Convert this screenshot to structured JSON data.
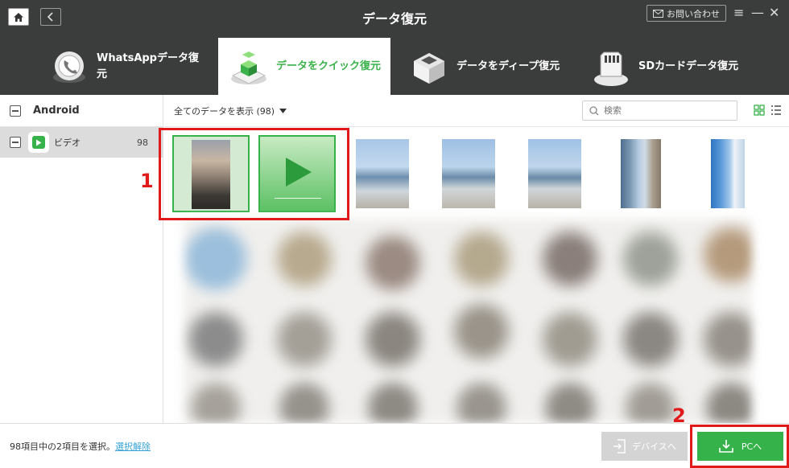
{
  "header": {
    "title": "データ復元",
    "contact_label": "お問い合わせ",
    "tabs": [
      {
        "label": "WhatsAppデータ復元",
        "line1": "WhatsAppデータ復",
        "line2": "元",
        "icon": "whatsapp-phone-icon",
        "active": false
      },
      {
        "label": "データをクイック復元",
        "icon": "quick-restore-cube-icon",
        "active": true
      },
      {
        "label": "データをディープ復元",
        "icon": "deep-restore-box-icon",
        "active": false
      },
      {
        "label": "SDカードデータ復元",
        "icon": "sd-card-icon",
        "active": false
      }
    ]
  },
  "sidebar": {
    "device_label": "Android",
    "items": [
      {
        "label": "ビデオ",
        "count": "98",
        "icon": "video-icon"
      }
    ]
  },
  "toolbar": {
    "filter_label": "全てのデータを表示 (98)",
    "search_placeholder": "検索"
  },
  "annotations": {
    "marker1": "1",
    "marker2": "2"
  },
  "footer": {
    "status_text": "98項目中の2項目を選択。",
    "deselect_link": "選択解除",
    "to_device_label": "デバイスへ",
    "to_pc_label": "PCへ"
  },
  "colors": {
    "accent": "#36b24a",
    "header_bg": "#3b3d3c",
    "highlight_red": "#e01a1a",
    "link": "#36a3d9"
  }
}
